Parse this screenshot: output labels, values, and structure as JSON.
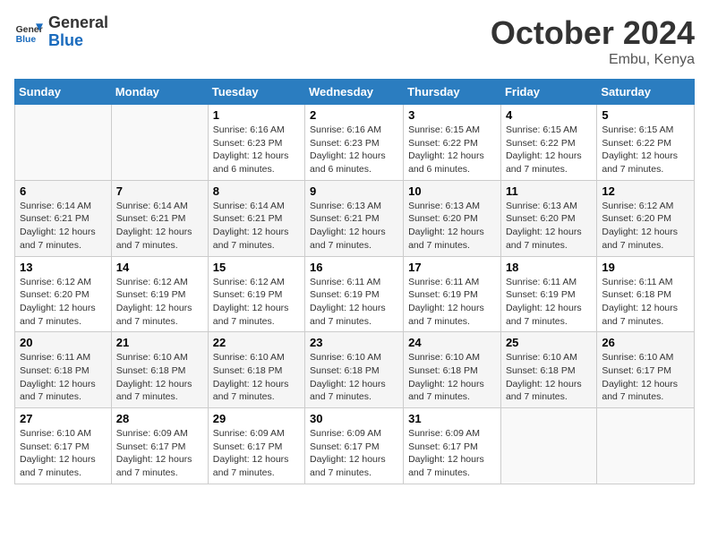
{
  "logo": {
    "line1": "General",
    "line2": "Blue"
  },
  "title": "October 2024",
  "location": "Embu, Kenya",
  "days_header": [
    "Sunday",
    "Monday",
    "Tuesday",
    "Wednesday",
    "Thursday",
    "Friday",
    "Saturday"
  ],
  "weeks": [
    [
      {
        "day": "",
        "info": ""
      },
      {
        "day": "",
        "info": ""
      },
      {
        "day": "1",
        "info": "Sunrise: 6:16 AM\nSunset: 6:23 PM\nDaylight: 12 hours and 6 minutes."
      },
      {
        "day": "2",
        "info": "Sunrise: 6:16 AM\nSunset: 6:23 PM\nDaylight: 12 hours and 6 minutes."
      },
      {
        "day": "3",
        "info": "Sunrise: 6:15 AM\nSunset: 6:22 PM\nDaylight: 12 hours and 6 minutes."
      },
      {
        "day": "4",
        "info": "Sunrise: 6:15 AM\nSunset: 6:22 PM\nDaylight: 12 hours and 7 minutes."
      },
      {
        "day": "5",
        "info": "Sunrise: 6:15 AM\nSunset: 6:22 PM\nDaylight: 12 hours and 7 minutes."
      }
    ],
    [
      {
        "day": "6",
        "info": "Sunrise: 6:14 AM\nSunset: 6:21 PM\nDaylight: 12 hours and 7 minutes."
      },
      {
        "day": "7",
        "info": "Sunrise: 6:14 AM\nSunset: 6:21 PM\nDaylight: 12 hours and 7 minutes."
      },
      {
        "day": "8",
        "info": "Sunrise: 6:14 AM\nSunset: 6:21 PM\nDaylight: 12 hours and 7 minutes."
      },
      {
        "day": "9",
        "info": "Sunrise: 6:13 AM\nSunset: 6:21 PM\nDaylight: 12 hours and 7 minutes."
      },
      {
        "day": "10",
        "info": "Sunrise: 6:13 AM\nSunset: 6:20 PM\nDaylight: 12 hours and 7 minutes."
      },
      {
        "day": "11",
        "info": "Sunrise: 6:13 AM\nSunset: 6:20 PM\nDaylight: 12 hours and 7 minutes."
      },
      {
        "day": "12",
        "info": "Sunrise: 6:12 AM\nSunset: 6:20 PM\nDaylight: 12 hours and 7 minutes."
      }
    ],
    [
      {
        "day": "13",
        "info": "Sunrise: 6:12 AM\nSunset: 6:20 PM\nDaylight: 12 hours and 7 minutes."
      },
      {
        "day": "14",
        "info": "Sunrise: 6:12 AM\nSunset: 6:19 PM\nDaylight: 12 hours and 7 minutes."
      },
      {
        "day": "15",
        "info": "Sunrise: 6:12 AM\nSunset: 6:19 PM\nDaylight: 12 hours and 7 minutes."
      },
      {
        "day": "16",
        "info": "Sunrise: 6:11 AM\nSunset: 6:19 PM\nDaylight: 12 hours and 7 minutes."
      },
      {
        "day": "17",
        "info": "Sunrise: 6:11 AM\nSunset: 6:19 PM\nDaylight: 12 hours and 7 minutes."
      },
      {
        "day": "18",
        "info": "Sunrise: 6:11 AM\nSunset: 6:19 PM\nDaylight: 12 hours and 7 minutes."
      },
      {
        "day": "19",
        "info": "Sunrise: 6:11 AM\nSunset: 6:18 PM\nDaylight: 12 hours and 7 minutes."
      }
    ],
    [
      {
        "day": "20",
        "info": "Sunrise: 6:11 AM\nSunset: 6:18 PM\nDaylight: 12 hours and 7 minutes."
      },
      {
        "day": "21",
        "info": "Sunrise: 6:10 AM\nSunset: 6:18 PM\nDaylight: 12 hours and 7 minutes."
      },
      {
        "day": "22",
        "info": "Sunrise: 6:10 AM\nSunset: 6:18 PM\nDaylight: 12 hours and 7 minutes."
      },
      {
        "day": "23",
        "info": "Sunrise: 6:10 AM\nSunset: 6:18 PM\nDaylight: 12 hours and 7 minutes."
      },
      {
        "day": "24",
        "info": "Sunrise: 6:10 AM\nSunset: 6:18 PM\nDaylight: 12 hours and 7 minutes."
      },
      {
        "day": "25",
        "info": "Sunrise: 6:10 AM\nSunset: 6:18 PM\nDaylight: 12 hours and 7 minutes."
      },
      {
        "day": "26",
        "info": "Sunrise: 6:10 AM\nSunset: 6:17 PM\nDaylight: 12 hours and 7 minutes."
      }
    ],
    [
      {
        "day": "27",
        "info": "Sunrise: 6:10 AM\nSunset: 6:17 PM\nDaylight: 12 hours and 7 minutes."
      },
      {
        "day": "28",
        "info": "Sunrise: 6:09 AM\nSunset: 6:17 PM\nDaylight: 12 hours and 7 minutes."
      },
      {
        "day": "29",
        "info": "Sunrise: 6:09 AM\nSunset: 6:17 PM\nDaylight: 12 hours and 7 minutes."
      },
      {
        "day": "30",
        "info": "Sunrise: 6:09 AM\nSunset: 6:17 PM\nDaylight: 12 hours and 7 minutes."
      },
      {
        "day": "31",
        "info": "Sunrise: 6:09 AM\nSunset: 6:17 PM\nDaylight: 12 hours and 7 minutes."
      },
      {
        "day": "",
        "info": ""
      },
      {
        "day": "",
        "info": ""
      }
    ]
  ]
}
